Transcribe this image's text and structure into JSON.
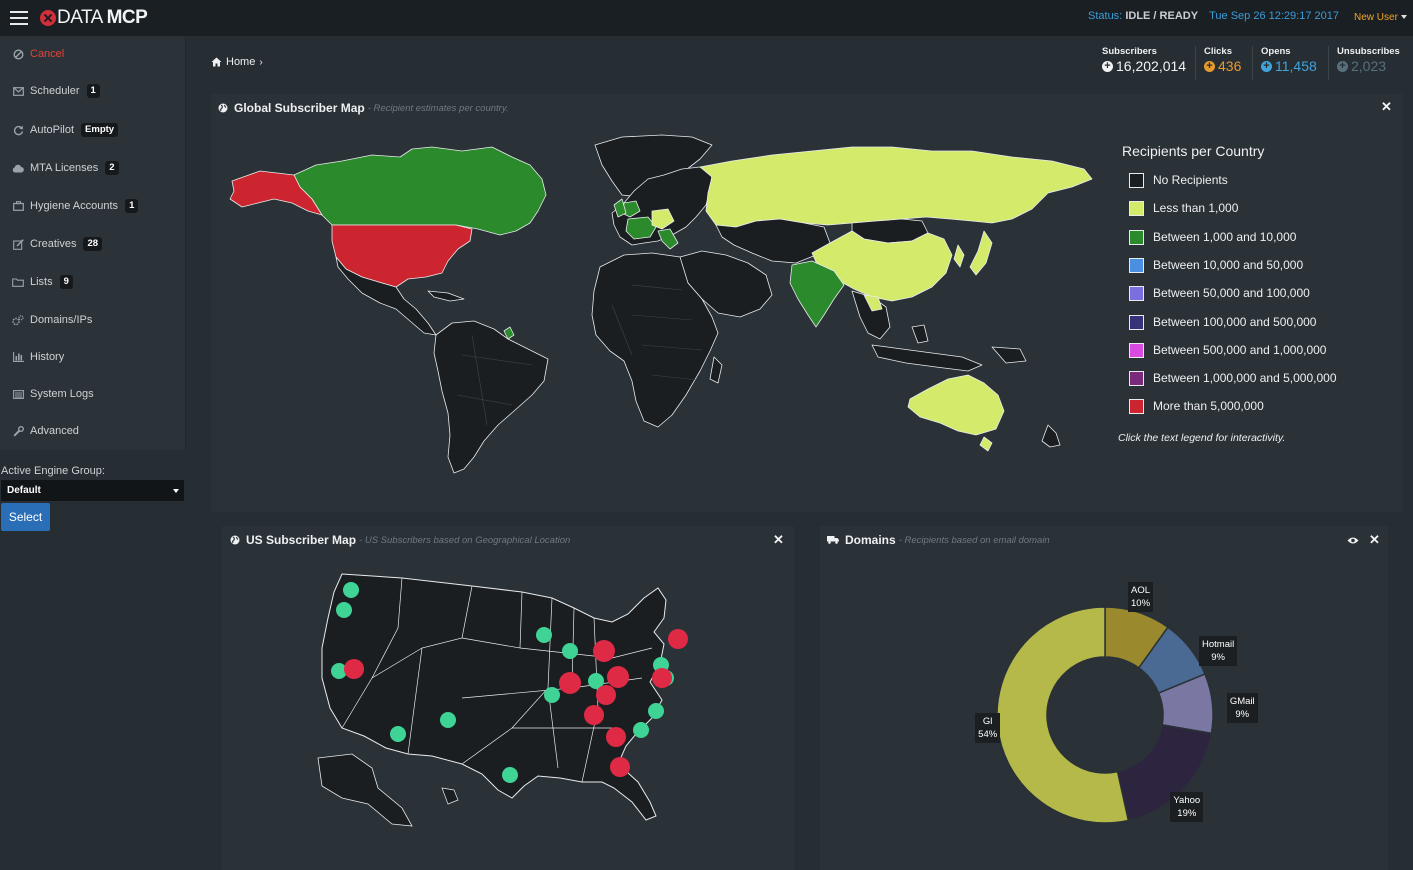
{
  "app": {
    "brand_prefix": "DATA",
    "brand_suffix": "MCP"
  },
  "header": {
    "status_label": "Status:",
    "status_value": "IDLE / READY",
    "datetime": "Tue Sep 26 12:29:17 2017",
    "user": "New User"
  },
  "sidebar": {
    "items": [
      {
        "label": "Cancel",
        "icon": "ban-icon"
      },
      {
        "label": "Scheduler",
        "icon": "envelope-icon",
        "badge": "1"
      },
      {
        "label": "AutoPilot",
        "icon": "refresh-icon",
        "badge": "Empty"
      },
      {
        "label": "MTA Licenses",
        "icon": "cloud-icon",
        "badge": "2"
      },
      {
        "label": "Hygiene Accounts",
        "icon": "briefcase-icon",
        "badge": "1"
      },
      {
        "label": "Creatives",
        "icon": "edit-icon",
        "badge": "28"
      },
      {
        "label": "Lists",
        "icon": "folder-icon",
        "badge": "9"
      },
      {
        "label": "Domains/IPs",
        "icon": "cogs-icon"
      },
      {
        "label": "History",
        "icon": "bar-chart-icon"
      },
      {
        "label": "System Logs",
        "icon": "list-icon"
      },
      {
        "label": "Advanced",
        "icon": "wrench-icon"
      }
    ],
    "engine_group_label": "Active Engine Group:",
    "engine_group_value": "Default",
    "select_button": "Select"
  },
  "breadcrumb": {
    "home": "Home"
  },
  "stats": [
    {
      "label": "Subscribers",
      "value": "16,202,014",
      "color": "#f2f3f4"
    },
    {
      "label": "Clicks",
      "value": "436",
      "color": "#e79b2c"
    },
    {
      "label": "Opens",
      "value": "11,458",
      "color": "#3fa4dc"
    },
    {
      "label": "Unsubscribes",
      "value": "2,023",
      "color": "#57707d"
    }
  ],
  "world_panel": {
    "title": "Global Subscriber Map",
    "subtitle": "- Recipient estimates per country.",
    "legend_title": "Recipients per Country",
    "legend": [
      {
        "label": "No Recipients",
        "color": "#1b1e21"
      },
      {
        "label": "Less than 1,000",
        "color": "#d4ea6b"
      },
      {
        "label": "Between 1,000 and 10,000",
        "color": "#2b8a2b"
      },
      {
        "label": "Between 10,000 and 50,000",
        "color": "#4a90e2"
      },
      {
        "label": "Between 50,000 and 100,000",
        "color": "#7b6fe0"
      },
      {
        "label": "Between 100,000 and 500,000",
        "color": "#36337a"
      },
      {
        "label": "Between 500,000 and 1,000,000",
        "color": "#d84ae0"
      },
      {
        "label": "Between 1,000,000 and 5,000,000",
        "color": "#7a2a7a"
      },
      {
        "label": "More than 5,000,000",
        "color": "#cc2530"
      }
    ],
    "note": "Click the text legend for interactivity."
  },
  "us_panel": {
    "title": "US Subscriber Map",
    "subtitle": "- US Subscribers based on Geographical Location"
  },
  "domains_panel": {
    "title": "Domains",
    "subtitle": "- Recipients based on email domain"
  },
  "chart_data": {
    "type": "pie",
    "categories": [
      "AOL",
      "Hotmail",
      "GMail",
      "Yahoo",
      "Gl"
    ],
    "values": [
      10,
      9,
      9,
      19,
      54
    ],
    "value_labels": [
      "10%",
      "9%",
      "9%",
      "19%",
      "54%"
    ],
    "colors": [
      "#9a8a2d",
      "#4a6a93",
      "#7a77a3",
      "#2d2540",
      "#b5b94a"
    ],
    "donut": true
  }
}
